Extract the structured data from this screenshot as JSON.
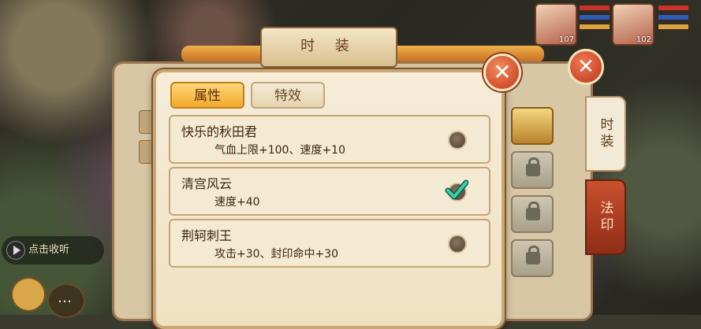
{
  "back_window": {
    "title": "时 装",
    "side_tabs": [
      "时装",
      "法印"
    ]
  },
  "popup": {
    "tabs": [
      "属性",
      "特效"
    ],
    "items": [
      {
        "name": "快乐的秋田君",
        "attr": "气血上限+100、速度+10",
        "selected": false
      },
      {
        "name": "清宫风云",
        "attr": "速度+40",
        "selected": true
      },
      {
        "name": "荆轲刺王",
        "attr": "攻击+30、封印命中+30",
        "selected": false
      }
    ]
  },
  "overlay": {
    "play_tip": "点击收听"
  },
  "portraits": [
    {
      "level": "107"
    },
    {
      "level": "102"
    }
  ],
  "colors": {
    "tab_active": "#f1a92c",
    "close_button": "#c0381b",
    "check": "#2fbf9a"
  }
}
